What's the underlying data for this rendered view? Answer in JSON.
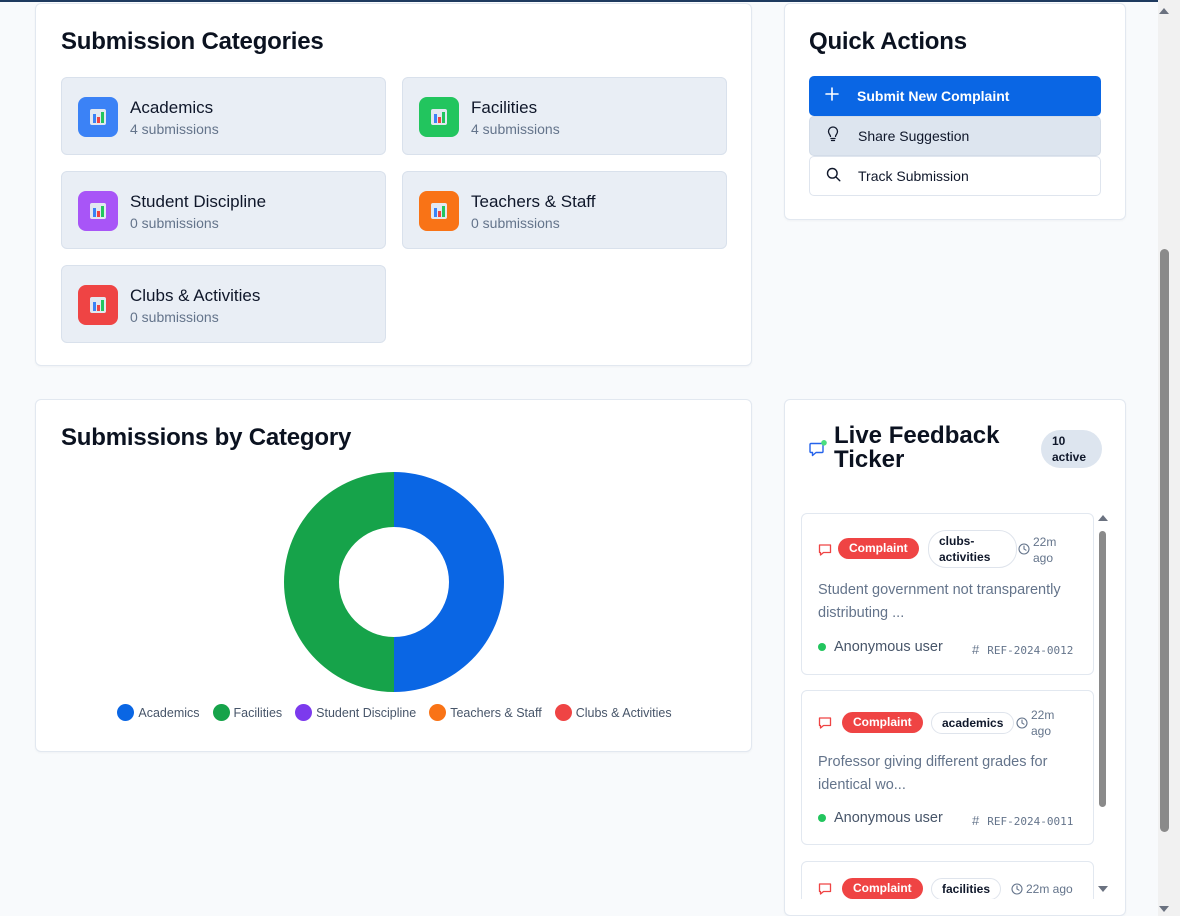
{
  "categories_section": {
    "title": "Submission Categories",
    "items": [
      {
        "name": "Academics",
        "count": "4 submissions",
        "color": "#3b82f6"
      },
      {
        "name": "Facilities",
        "count": "4 submissions",
        "color": "#22c55e"
      },
      {
        "name": "Student Discipline",
        "count": "0 submissions",
        "color": "#a855f7"
      },
      {
        "name": "Teachers & Staff",
        "count": "0 submissions",
        "color": "#f97316"
      },
      {
        "name": "Clubs & Activities",
        "count": "0 submissions",
        "color": "#ef4444"
      }
    ]
  },
  "quick_actions": {
    "title": "Quick Actions",
    "submit_label": "Submit New Complaint",
    "suggest_label": "Share Suggestion",
    "track_label": "Track Submission"
  },
  "chart_section": {
    "title": "Submissions by Category"
  },
  "chart_data": {
    "type": "pie",
    "donut": true,
    "categories": [
      "Academics",
      "Facilities",
      "Student Discipline",
      "Teachers & Staff",
      "Clubs & Activities"
    ],
    "values": [
      4,
      4,
      0,
      0,
      0
    ],
    "colors": [
      "#0a66e4",
      "#16a34a",
      "#7c3aed",
      "#f97316",
      "#ef4444"
    ],
    "legend_position": "bottom"
  },
  "ticker": {
    "title": "Live Feedback Ticker",
    "active_badge": "10 active",
    "items": [
      {
        "type": "Complaint",
        "category": "clubs-activities",
        "time": "22m ago",
        "text": "Student government not transparently distributing ...",
        "user": "Anonymous user",
        "ref": "REF-2024-0012"
      },
      {
        "type": "Complaint",
        "category": "academics",
        "time": "22m ago",
        "text": "Professor giving different grades for identical wo...",
        "user": "Anonymous user",
        "ref": "REF-2024-0011"
      },
      {
        "type": "Complaint",
        "category": "facilities",
        "time": "22m ago"
      }
    ]
  }
}
